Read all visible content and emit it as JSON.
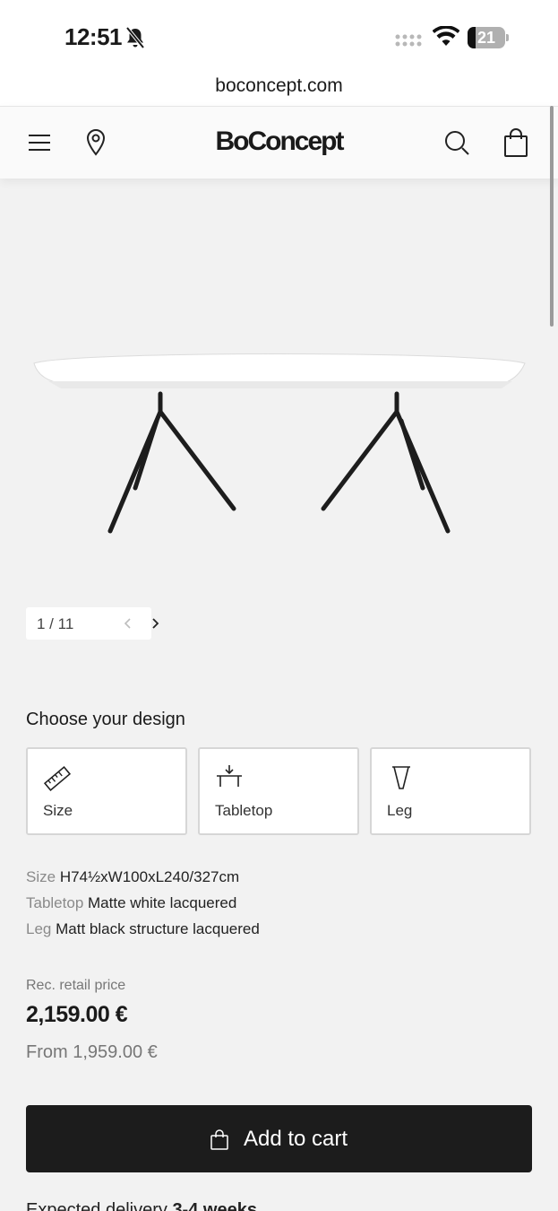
{
  "status_bar": {
    "time": "12:51",
    "battery_level": "21",
    "battery_fraction": 0.21
  },
  "browser": {
    "url": "boconcept.com"
  },
  "header": {
    "logo": "BoConcept",
    "icons": [
      "menu-icon",
      "location-pin-icon",
      "search-icon",
      "shopping-bag-icon"
    ]
  },
  "gallery": {
    "current": "1",
    "total": "11",
    "counter_text": "1 / 11"
  },
  "design": {
    "heading": "Choose your design",
    "options": [
      {
        "label": "Size",
        "icon": "ruler-icon"
      },
      {
        "label": "Tabletop",
        "icon": "tabletop-icon"
      },
      {
        "label": "Leg",
        "icon": "table-leg-icon"
      }
    ]
  },
  "specs": [
    {
      "key": "Size",
      "value": "H74½xW100xL240/327cm"
    },
    {
      "key": "Tabletop",
      "value": "Matte white lacquered"
    },
    {
      "key": "Leg",
      "value": "Matt black structure lacquered"
    }
  ],
  "pricing": {
    "caption": "Rec. retail price",
    "price": "2,159.00 €",
    "from": "From 1,959.00 €"
  },
  "cta": {
    "add_to_cart": "Add to cart"
  },
  "delivery": {
    "label": "Expected delivery",
    "value": "3-4 weeks"
  },
  "colors": {
    "cta_background": "#1c1c1c",
    "page_background": "#f2f2f2"
  }
}
